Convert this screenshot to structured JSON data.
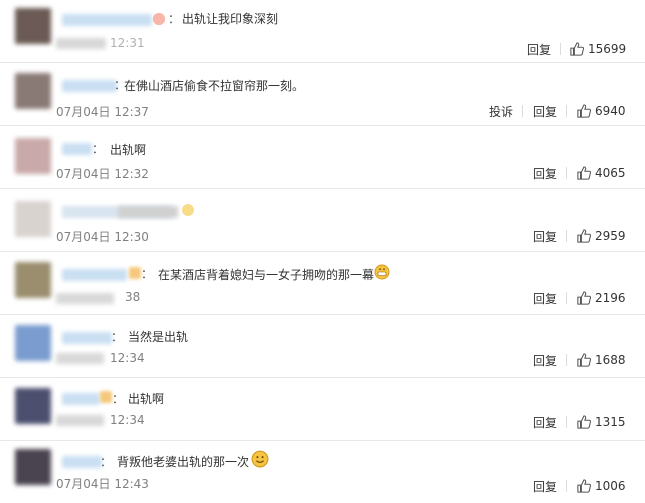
{
  "colors": {
    "blur_name": "#c9dff2",
    "text": "#333333",
    "time": "#808080"
  },
  "icons": {
    "like": "thumbs-up-icon",
    "emoji_grin": "grin-emoji-icon",
    "emoji_smile": "smile-emoji-icon"
  },
  "comments": [
    {
      "text": "出轨让我印象深刻",
      "time": "12:31",
      "reply": "回复",
      "likes": "15699"
    },
    {
      "text": "在佛山酒店偷食不拉窗帘那一刻。",
      "time": "07月04日 12:37",
      "report": "投诉",
      "reply": "回复",
      "likes": "6940"
    },
    {
      "text": "出轨啊",
      "time": "07月04日 12:32",
      "reply": "回复",
      "likes": "4065"
    },
    {
      "text": "",
      "time": "07月04日 12:30",
      "reply": "回复",
      "likes": "2959"
    },
    {
      "text": "在某酒店背着媳妇与一女子拥吻的那一幕",
      "time": "38",
      "reply": "回复",
      "likes": "2196"
    },
    {
      "text": "当然是出轨",
      "time": "12:34",
      "reply": "回复",
      "likes": "1688"
    },
    {
      "text": "出轨啊",
      "time": "12:34",
      "reply": "回复",
      "likes": "1315"
    },
    {
      "text": "背叛他老婆出轨的那一次",
      "time": "07月04日 12:43",
      "reply": "回复",
      "likes": "1006"
    }
  ]
}
